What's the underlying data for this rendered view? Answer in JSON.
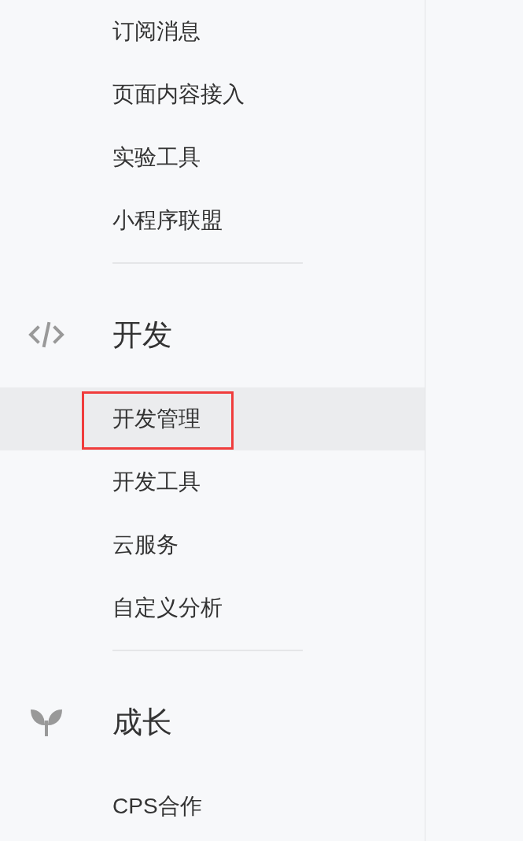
{
  "sections": [
    {
      "items": [
        {
          "label": "订阅消息",
          "selected": false,
          "highlighted": false
        },
        {
          "label": "页面内容接入",
          "selected": false,
          "highlighted": false
        },
        {
          "label": "实验工具",
          "selected": false,
          "highlighted": false
        },
        {
          "label": "小程序联盟",
          "selected": false,
          "highlighted": false
        }
      ]
    },
    {
      "header": {
        "kind": "code",
        "title": "开发"
      },
      "items": [
        {
          "label": "开发管理",
          "selected": true,
          "highlighted": true
        },
        {
          "label": "开发工具",
          "selected": false,
          "highlighted": false
        },
        {
          "label": "云服务",
          "selected": false,
          "highlighted": false
        },
        {
          "label": "自定义分析",
          "selected": false,
          "highlighted": false
        }
      ]
    },
    {
      "header": {
        "kind": "sprout",
        "title": "成长"
      },
      "items": [
        {
          "label": "CPS合作",
          "selected": false,
          "highlighted": false
        }
      ]
    }
  ]
}
